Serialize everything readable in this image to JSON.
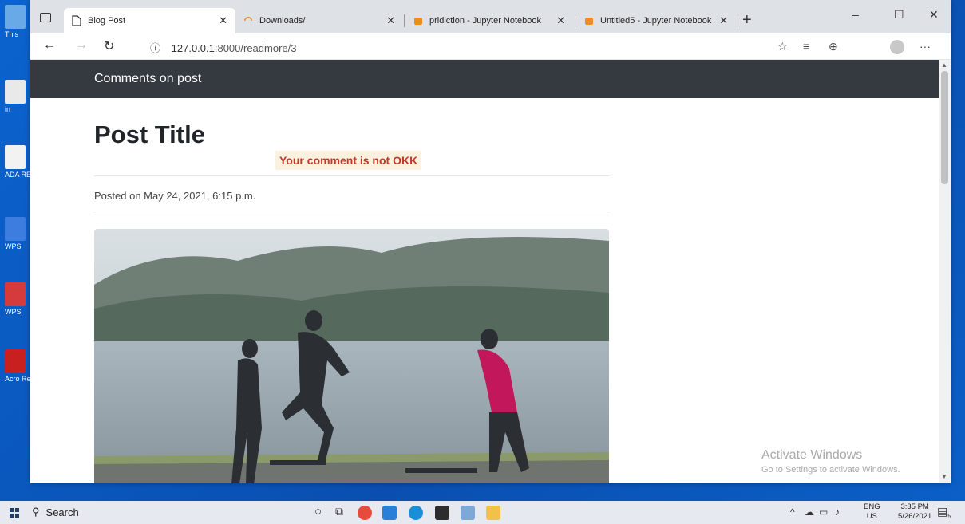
{
  "desktop": {
    "icons": [
      {
        "label": "This",
        "color": "#6aa9e8"
      },
      {
        "label": "in",
        "color": "#e9e9e9"
      },
      {
        "label": "ADA RESU",
        "color": "#f2f2f2"
      },
      {
        "label": "WPS",
        "color": "#3d7de0"
      },
      {
        "label": "WPS",
        "color": "#d63b3b"
      },
      {
        "label": "Acro Read",
        "color": "#c8201f"
      }
    ]
  },
  "browser": {
    "tabs": [
      {
        "title": "Blog Post",
        "icon": "page-icon",
        "active": true
      },
      {
        "title": "Downloads/",
        "icon": "loading-icon",
        "active": false
      },
      {
        "title": "pridiction - Jupyter Notebook",
        "icon": "jupyter-icon",
        "active": false
      },
      {
        "title": "Untitled5 - Jupyter Notebook",
        "icon": "jupyter-icon",
        "active": false
      }
    ],
    "new_tab_label": "+",
    "address": {
      "host": "127.0.0.1",
      "path": ":8000/readmore/3"
    },
    "window_controls": {
      "minimize": "–",
      "maximize": "☐",
      "close": "✕"
    },
    "more_label": "···"
  },
  "page": {
    "navbar_title": "Comments on post",
    "post_title": "Post Title",
    "alert": "Your comment is not OKK",
    "posted": "Posted on May 24, 2021, 6:15 p.m."
  },
  "watermark": {
    "line1": "Activate Windows",
    "line2": "Go to Settings to activate Windows."
  },
  "taskbar": {
    "search_label": "Search",
    "lang_top": "ENG",
    "lang_bottom": "US",
    "time": "3:35 PM",
    "date": "5/26/2021",
    "notification_count": "5"
  }
}
